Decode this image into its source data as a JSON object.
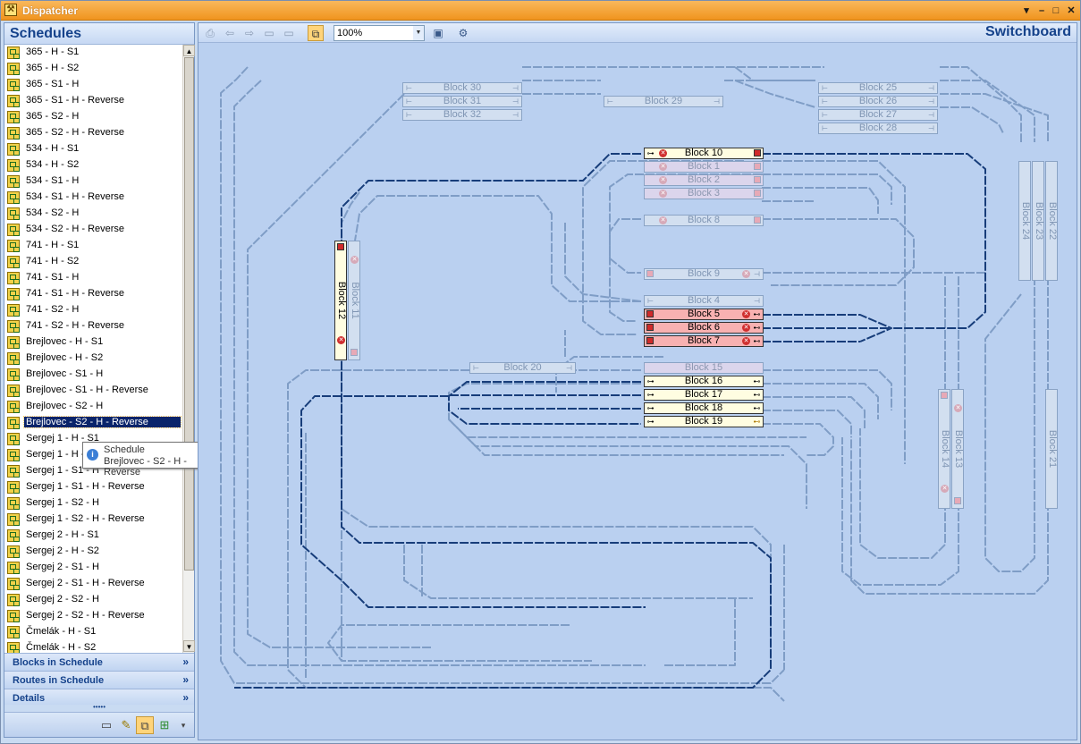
{
  "window": {
    "title": "Dispatcher",
    "buttons": [
      "▾",
      "–",
      "□",
      "✕"
    ]
  },
  "schedules": {
    "header": "Schedules",
    "selected_index": 23,
    "items": [
      "365 - H - S1",
      "365 - H - S2",
      "365 - S1 - H",
      "365 - S1 - H - Reverse",
      "365 - S2 - H",
      "365 - S2 - H - Reverse",
      "534 - H - S1",
      "534 - H - S2",
      "534 - S1 - H",
      "534 - S1 - H - Reverse",
      "534 - S2 - H",
      "534 - S2 - H - Reverse",
      "741 - H - S1",
      "741 - H - S2",
      "741 - S1 - H",
      "741 - S1 - H - Reverse",
      "741 - S2 - H",
      "741 - S2 - H - Reverse",
      "Brejlovec - H - S1",
      "Brejlovec - H - S2",
      "Brejlovec - S1 - H",
      "Brejlovec - S1 - H - Reverse",
      "Brejlovec - S2 - H",
      "Brejlovec - S2 - H - Reverse",
      "Sergej 1 - H - S1",
      "Sergej 1 - H - S2",
      "Sergej 1 - S1 - H",
      "Sergej 1 - S1 - H - Reverse",
      "Sergej 1 - S2 - H",
      "Sergej 1 - S2 - H - Reverse",
      "Sergej 2 - H - S1",
      "Sergej 2 - H - S2",
      "Sergej 2 - S1 - H",
      "Sergej 2 - S1 - H - Reverse",
      "Sergej 2 - S2 - H",
      "Sergej 2 - S2 - H - Reverse",
      "Čmelák - H - S1",
      "Čmelák - H - S2"
    ]
  },
  "tooltip": {
    "title": "Schedule",
    "text": "Brejlovec - S2 - H - Reverse"
  },
  "accordion": [
    {
      "label": "Blocks in Schedule",
      "chevron": "»"
    },
    {
      "label": "Routes in Schedule",
      "chevron": "»"
    },
    {
      "label": "Details",
      "chevron": "»"
    }
  ],
  "grip": "•••••",
  "toolbar": {
    "zoom": "100%",
    "title": "Switchboard"
  },
  "blocks": {
    "b30": "Block 30",
    "b31": "Block 31",
    "b32": "Block 32",
    "b29": "Block 29",
    "b25": "Block 25",
    "b26": "Block 26",
    "b27": "Block 27",
    "b28": "Block 28",
    "b10": "Block 10",
    "b1": "Block 1",
    "b2": "Block 2",
    "b3": "Block 3",
    "b8": "Block 8",
    "b9": "Block 9",
    "b4": "Block 4",
    "b5": "Block 5",
    "b6": "Block 6",
    "b7": "Block 7",
    "b20": "Block 20",
    "b15": "Block 15",
    "b16": "Block 16",
    "b17": "Block 17",
    "b18": "Block 18",
    "b19": "Block 19",
    "b12": "Block 12",
    "b11": "Block 11",
    "b24": "Block 24",
    "b23": "Block 23",
    "b22": "Block 22",
    "b14": "Block 14",
    "b13": "Block 13",
    "b21": "Block 21"
  },
  "colors": {
    "active_track": "#173d7a",
    "inactive_track": "#7f9dc6",
    "occupied": "#f8b1b1",
    "route": "#fffde1"
  }
}
